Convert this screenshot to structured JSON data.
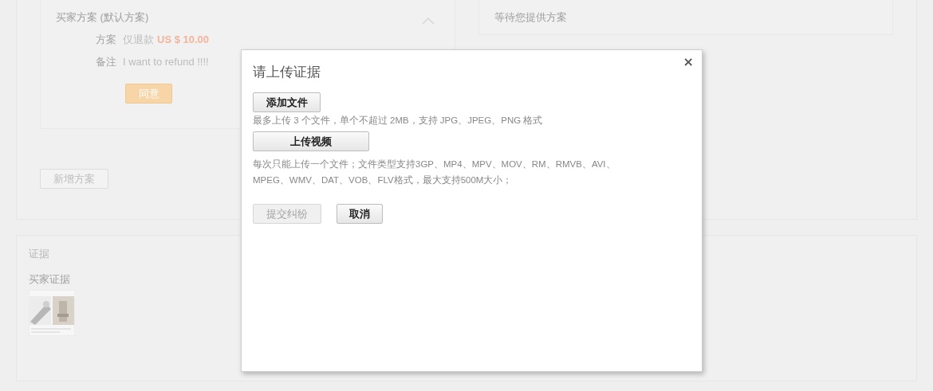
{
  "buyer_plan": {
    "title": "买家方案 (默认方案)",
    "expanded": true,
    "rows": [
      {
        "label": "方案",
        "value": "仅退款",
        "amount": "US $ 10.00"
      },
      {
        "label": "备注",
        "value": "I want to refund !!!!"
      }
    ],
    "agree_button": "同意"
  },
  "seller_plan": {
    "title": "等待您提供方案"
  },
  "add_plan_button": "新增方案",
  "evidence": {
    "title": "证据",
    "buyer_evidence_label": "买家证据"
  },
  "dialog": {
    "title": "请上传证据",
    "close": "×",
    "add_file_button": "添加文件",
    "file_hint": "最多上传 3 个文件，单个不超过 2MB，支持 JPG、JPEG、PNG 格式",
    "upload_video_button": "上传视频",
    "video_hint_lines": [
      "每次只能上传一个文件；文件类型支持3GP、MP4、MPV、MOV、RM、RMVB、AVI、",
      "MPEG、WMV、DAT、VOB、FLV格式，最大支持500M大小；"
    ],
    "buttons": [
      {
        "label": "提交纠纷",
        "disabled": true
      },
      {
        "label": "取消",
        "disabled": false
      }
    ]
  }
}
